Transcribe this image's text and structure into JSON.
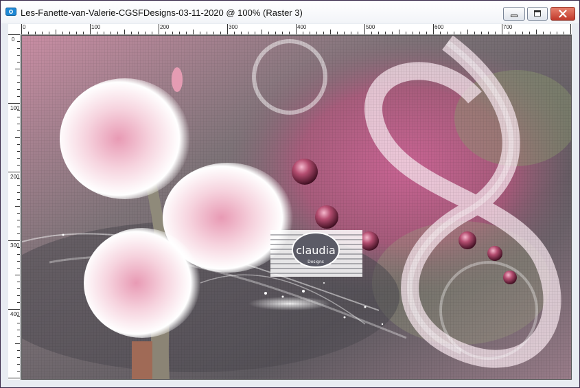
{
  "window": {
    "title": "Les-Fanette-van-Valerie-CGSFDesigns-03-11-2020 @ 100% (Raster 3)",
    "icon": "app-document-icon",
    "controls": {
      "minimize_icon": "minimize-icon",
      "maximize_icon": "maximize-icon",
      "close_icon": "close-icon"
    }
  },
  "ruler": {
    "horizontal_labels": [
      "0",
      "100",
      "200",
      "300",
      "400",
      "500",
      "600",
      "700"
    ],
    "vertical_labels": [
      "0",
      "100",
      "200",
      "300",
      "400"
    ]
  },
  "canvas": {
    "watermark": {
      "name": "claudia",
      "subtitle": "Designs"
    }
  },
  "colors": {
    "accent_pink": "#d98aa8",
    "bead": "#8e2a48",
    "close_button": "#c0392b",
    "background_gray": "#6f6a70"
  }
}
